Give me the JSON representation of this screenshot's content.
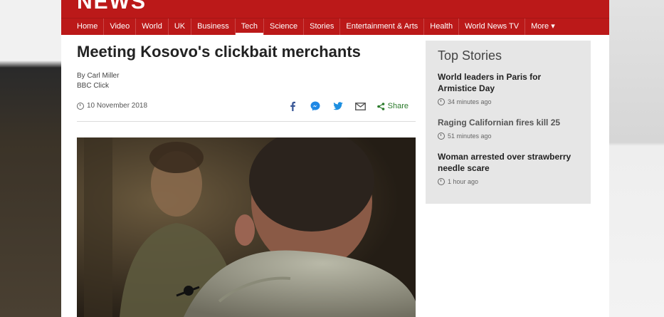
{
  "masthead": {
    "logo_text": "NEWS"
  },
  "nav": {
    "items": [
      {
        "label": "Home"
      },
      {
        "label": "Video"
      },
      {
        "label": "World"
      },
      {
        "label": "UK"
      },
      {
        "label": "Business"
      },
      {
        "label": "Tech",
        "active": true
      },
      {
        "label": "Science"
      },
      {
        "label": "Stories"
      },
      {
        "label": "Entertainment & Arts"
      },
      {
        "label": "Health"
      },
      {
        "label": "World News TV"
      },
      {
        "label": "More ▾"
      }
    ]
  },
  "article": {
    "headline": "Meeting Kosovo's clickbait merchants",
    "author": "By Carl Miller",
    "source": "BBC Click",
    "date": "10 November 2018",
    "share_label": "Share"
  },
  "top_stories": {
    "title": "Top Stories",
    "stories": [
      {
        "title": "World leaders in Paris for Armistice Day",
        "time": "34 minutes ago"
      },
      {
        "title": "Raging Californian fires kill 25",
        "time": "51 minutes ago"
      },
      {
        "title": "Woman arrested over strawberry needle scare",
        "time": "1 hour ago"
      }
    ]
  },
  "colors": {
    "brand_red": "#bb1919",
    "share_green": "#2a7a2a",
    "facebook_blue": "#3b5998",
    "twitter_blue": "#1da1f2"
  }
}
